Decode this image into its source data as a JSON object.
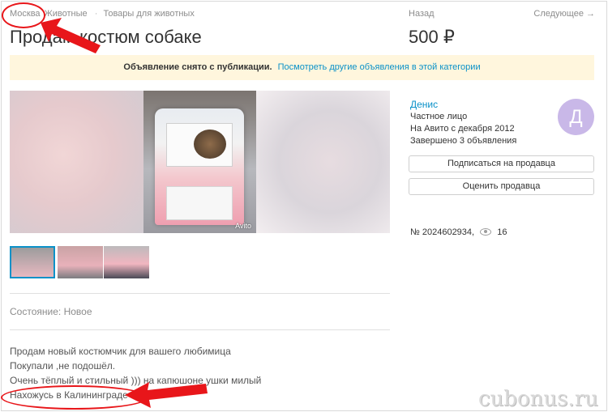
{
  "breadcrumb": {
    "items": [
      "Москва",
      "Животные",
      "Товары для животных"
    ]
  },
  "nav": {
    "back": "Назад",
    "next": "Следующее →"
  },
  "listing": {
    "title": "Продам костюм собаке",
    "price": "500 ₽"
  },
  "banner": {
    "text": "Объявление снято с публикации.",
    "link": "Посмотреть другие объявления в этой категории"
  },
  "gallery": {
    "watermark": "Avito",
    "thumbnail_count": 3
  },
  "details": {
    "condition_label": "Состояние:",
    "condition_value": "Новое",
    "description": [
      "Продам новый костюмчик для вашего любимица",
      "Покупали ,не подошёл.",
      "Очень тёплый и стильный ))) на капюшоне ушки милый",
      "Нахожусь в Калининграде"
    ]
  },
  "seller": {
    "name": "Денис",
    "type": "Частное лицо",
    "since": "На Авито с декабря 2012",
    "completed": "Завершено 3 объявления",
    "avatar_letter": "Д",
    "avatar_color": "#c9b8e8",
    "subscribe_button": "Подписаться на продавца",
    "rate_button": "Оценить продавца"
  },
  "meta": {
    "ad_number": "№ 2024602934,",
    "views": "16"
  },
  "watermark_text": "cubonus.ru",
  "colors": {
    "link": "#0a91c8",
    "banner_bg": "#fff6dd",
    "annotation": "#e8161a"
  }
}
